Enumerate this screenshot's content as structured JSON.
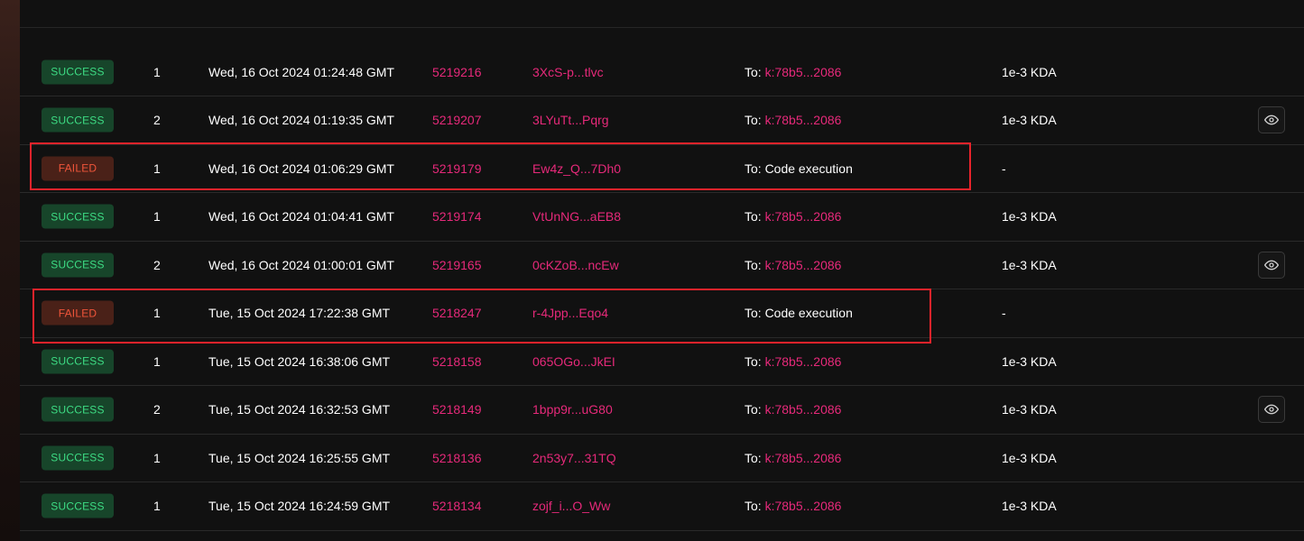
{
  "transactions": [
    {
      "status": "SUCCESS",
      "index": "1",
      "time": "Wed, 16 Oct 2024 01:24:48 GMT",
      "block": "5219216",
      "hash": "3XcS-p...tlvc",
      "to_prefix": "To: ",
      "to": "k:78b5...2086",
      "amount": "1e-3 KDA",
      "has_view": false
    },
    {
      "status": "SUCCESS",
      "index": "2",
      "time": "Wed, 16 Oct 2024 01:19:35 GMT",
      "block": "5219207",
      "hash": "3LYuTt...Pqrg",
      "to_prefix": "To: ",
      "to": "k:78b5...2086",
      "amount": "1e-3 KDA",
      "has_view": true
    },
    {
      "status": "FAILED",
      "index": "1",
      "time": "Wed, 16 Oct 2024 01:06:29 GMT",
      "block": "5219179",
      "hash": "Ew4z_Q...7Dh0",
      "to_prefix": "To: Code execution",
      "to": "",
      "amount": "-",
      "has_view": false
    },
    {
      "status": "SUCCESS",
      "index": "1",
      "time": "Wed, 16 Oct 2024 01:04:41 GMT",
      "block": "5219174",
      "hash": "VtUnNG...aEB8",
      "to_prefix": "To: ",
      "to": "k:78b5...2086",
      "amount": "1e-3 KDA",
      "has_view": false
    },
    {
      "status": "SUCCESS",
      "index": "2",
      "time": "Wed, 16 Oct 2024 01:00:01 GMT",
      "block": "5219165",
      "hash": "0cKZoB...ncEw",
      "to_prefix": "To: ",
      "to": "k:78b5...2086",
      "amount": "1e-3 KDA",
      "has_view": true
    },
    {
      "status": "FAILED",
      "index": "1",
      "time": "Tue, 15 Oct 2024 17:22:38 GMT",
      "block": "5218247",
      "hash": "r-4Jpp...Eqo4",
      "to_prefix": "To: Code execution",
      "to": "",
      "amount": "-",
      "has_view": false
    },
    {
      "status": "SUCCESS",
      "index": "1",
      "time": "Tue, 15 Oct 2024 16:38:06 GMT",
      "block": "5218158",
      "hash": "065OGo...JkEI",
      "to_prefix": "To: ",
      "to": "k:78b5...2086",
      "amount": "1e-3 KDA",
      "has_view": false
    },
    {
      "status": "SUCCESS",
      "index": "2",
      "time": "Tue, 15 Oct 2024 16:32:53 GMT",
      "block": "5218149",
      "hash": "1bpp9r...uG80",
      "to_prefix": "To: ",
      "to": "k:78b5...2086",
      "amount": "1e-3 KDA",
      "has_view": true
    },
    {
      "status": "SUCCESS",
      "index": "1",
      "time": "Tue, 15 Oct 2024 16:25:55 GMT",
      "block": "5218136",
      "hash": "2n53y7...31TQ",
      "to_prefix": "To: ",
      "to": "k:78b5...2086",
      "amount": "1e-3 KDA",
      "has_view": false
    },
    {
      "status": "SUCCESS",
      "index": "1",
      "time": "Tue, 15 Oct 2024 16:24:59 GMT",
      "block": "5218134",
      "hash": "zojf_i...O_Ww",
      "to_prefix": "To: ",
      "to": "k:78b5...2086",
      "amount": "1e-3 KDA",
      "has_view": false
    }
  ],
  "icons": {
    "view": "eye-icon"
  },
  "colors": {
    "success_bg": "#17452a",
    "success_text": "#3ddc84",
    "failed_bg": "#4a2118",
    "failed_text": "#f0553a",
    "link": "#e6297a",
    "highlight": "#e8232b"
  }
}
